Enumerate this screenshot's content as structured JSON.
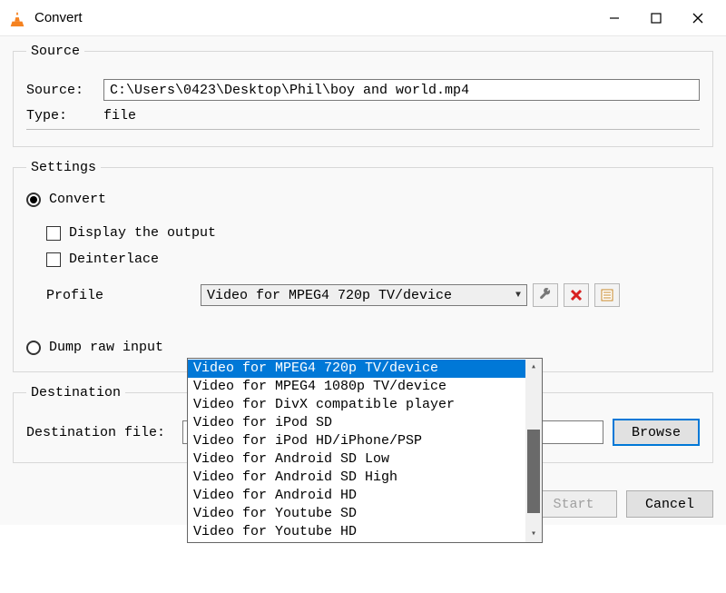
{
  "window": {
    "title": "Convert"
  },
  "source": {
    "legend": "Source",
    "source_label": "Source:",
    "source_value": "C:\\Users\\0423\\Desktop\\Phil\\boy and world.mp4",
    "type_label": "Type:",
    "type_value": "file"
  },
  "settings": {
    "legend": "Settings",
    "convert_label": "Convert",
    "display_output_label": "Display the output",
    "deinterlace_label": "Deinterlace",
    "profile_label": "Profile",
    "profile_selected": "Video for MPEG4 720p TV/device",
    "profile_options": [
      "Video for MPEG4 720p TV/device",
      "Video for MPEG4 1080p TV/device",
      "Video for DivX compatible player",
      "Video for iPod SD",
      "Video for iPod HD/iPhone/PSP",
      "Video for Android SD Low",
      "Video for Android SD High",
      "Video for Android HD",
      "Video for Youtube SD",
      "Video for Youtube HD"
    ],
    "dump_raw_label": "Dump raw input"
  },
  "destination": {
    "legend": "Destination",
    "file_label": "Destination file:",
    "file_value": "",
    "browse_label": "Browse"
  },
  "footer": {
    "start_label": "Start",
    "cancel_label": "Cancel"
  },
  "icons": {
    "wrench": "wrench-icon",
    "delete": "delete-icon",
    "new": "new-profile-icon"
  }
}
